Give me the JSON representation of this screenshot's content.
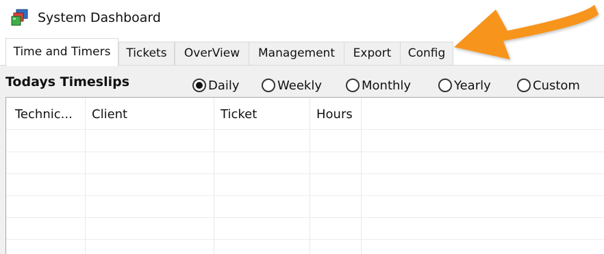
{
  "window": {
    "title": "System Dashboard",
    "icon": "app-icon"
  },
  "tabs": [
    {
      "label": "Time and Timers",
      "active": true
    },
    {
      "label": "Tickets",
      "active": false
    },
    {
      "label": "OverView",
      "active": false
    },
    {
      "label": "Management",
      "active": false
    },
    {
      "label": "Export",
      "active": false
    },
    {
      "label": "Config",
      "active": false
    }
  ],
  "section": {
    "title": "Todays Timeslips"
  },
  "period_options": [
    {
      "label": "Daily",
      "selected": true
    },
    {
      "label": "Weekly",
      "selected": false
    },
    {
      "label": "Monthly",
      "selected": false
    },
    {
      "label": "Yearly",
      "selected": false
    },
    {
      "label": "Custom",
      "selected": false
    }
  ],
  "table": {
    "columns": [
      "Technic...",
      "Client",
      "Ticket",
      "Hours"
    ],
    "rows": []
  },
  "annotation": {
    "icon": "arrow-pointer-icon",
    "color": "#f7941d"
  }
}
